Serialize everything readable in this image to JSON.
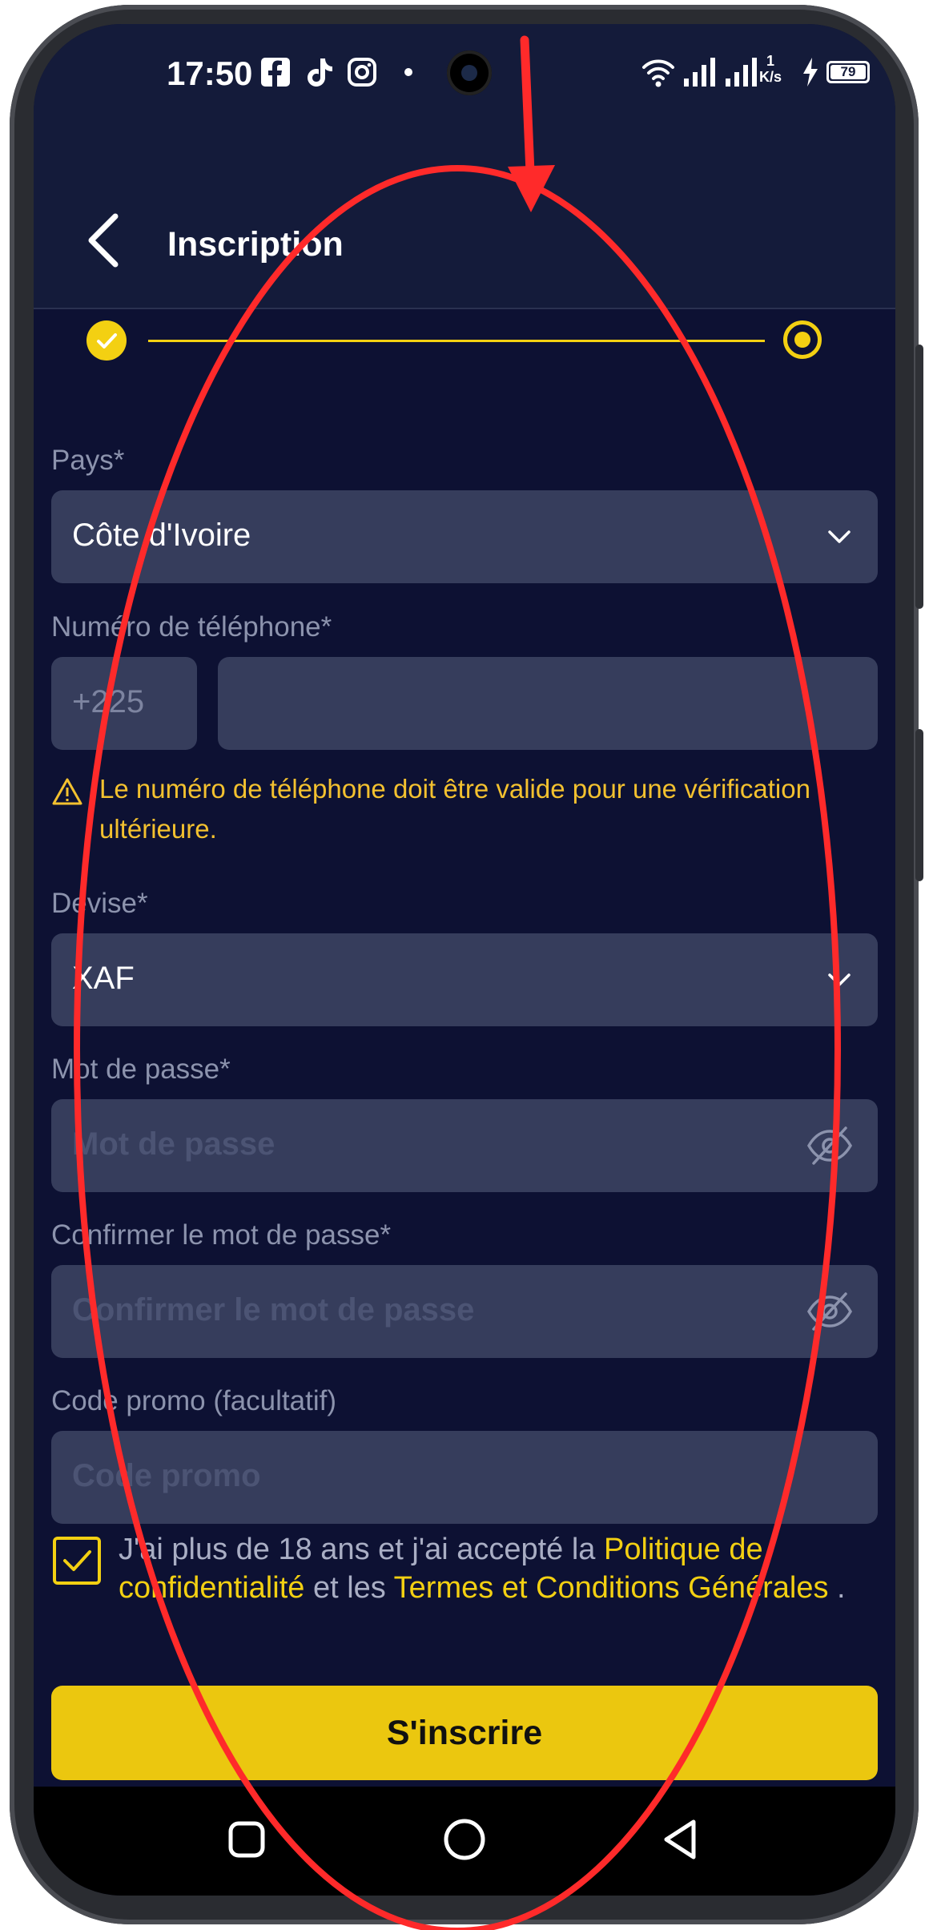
{
  "status_bar": {
    "time": "17:50",
    "net_speed_value": "1",
    "net_speed_unit": "K/s",
    "battery": "79",
    "icons": [
      "facebook-icon",
      "tiktok-icon",
      "instagram-icon",
      "wifi-icon",
      "signal-icon",
      "charging-icon"
    ]
  },
  "header": {
    "title": "Inscription",
    "back_icon": "chevron-left-icon"
  },
  "stepper": {
    "total_steps": 2,
    "current_step": 2
  },
  "form": {
    "country_label": "Pays*",
    "country_value": "Côte d'Ivoire",
    "phone_label": "Numéro de téléphone*",
    "phone_prefix": "+225",
    "phone_value": "",
    "phone_warning": "Le numéro de téléphone doit être valide pour une vérification ultérieure.",
    "currency_label": "Devise*",
    "currency_value": "XAF",
    "password_label": "Mot de passe*",
    "password_placeholder": "Mot de passe",
    "confirm_label": "Confirmer le mot de passe*",
    "confirm_placeholder": "Confirmer le mot de passe",
    "promo_label": "Code promo (facultatif)",
    "promo_placeholder": "Code promo",
    "terms_prefix": "J'ai plus de 18 ans et j'ai accepté la ",
    "terms_privacy": "Politique de confidentialité",
    "terms_middle": " et les ",
    "terms_conditions": "Termes et Conditions Générales",
    "terms_suffix": " .",
    "terms_checked": true,
    "submit_label": "S'inscrire"
  },
  "colors": {
    "background": "#0d1133",
    "header": "#141b3a",
    "field": "#363d5c",
    "accent": "#f3d012",
    "warning": "#f3c12f",
    "annotation": "#ff2a2a"
  }
}
